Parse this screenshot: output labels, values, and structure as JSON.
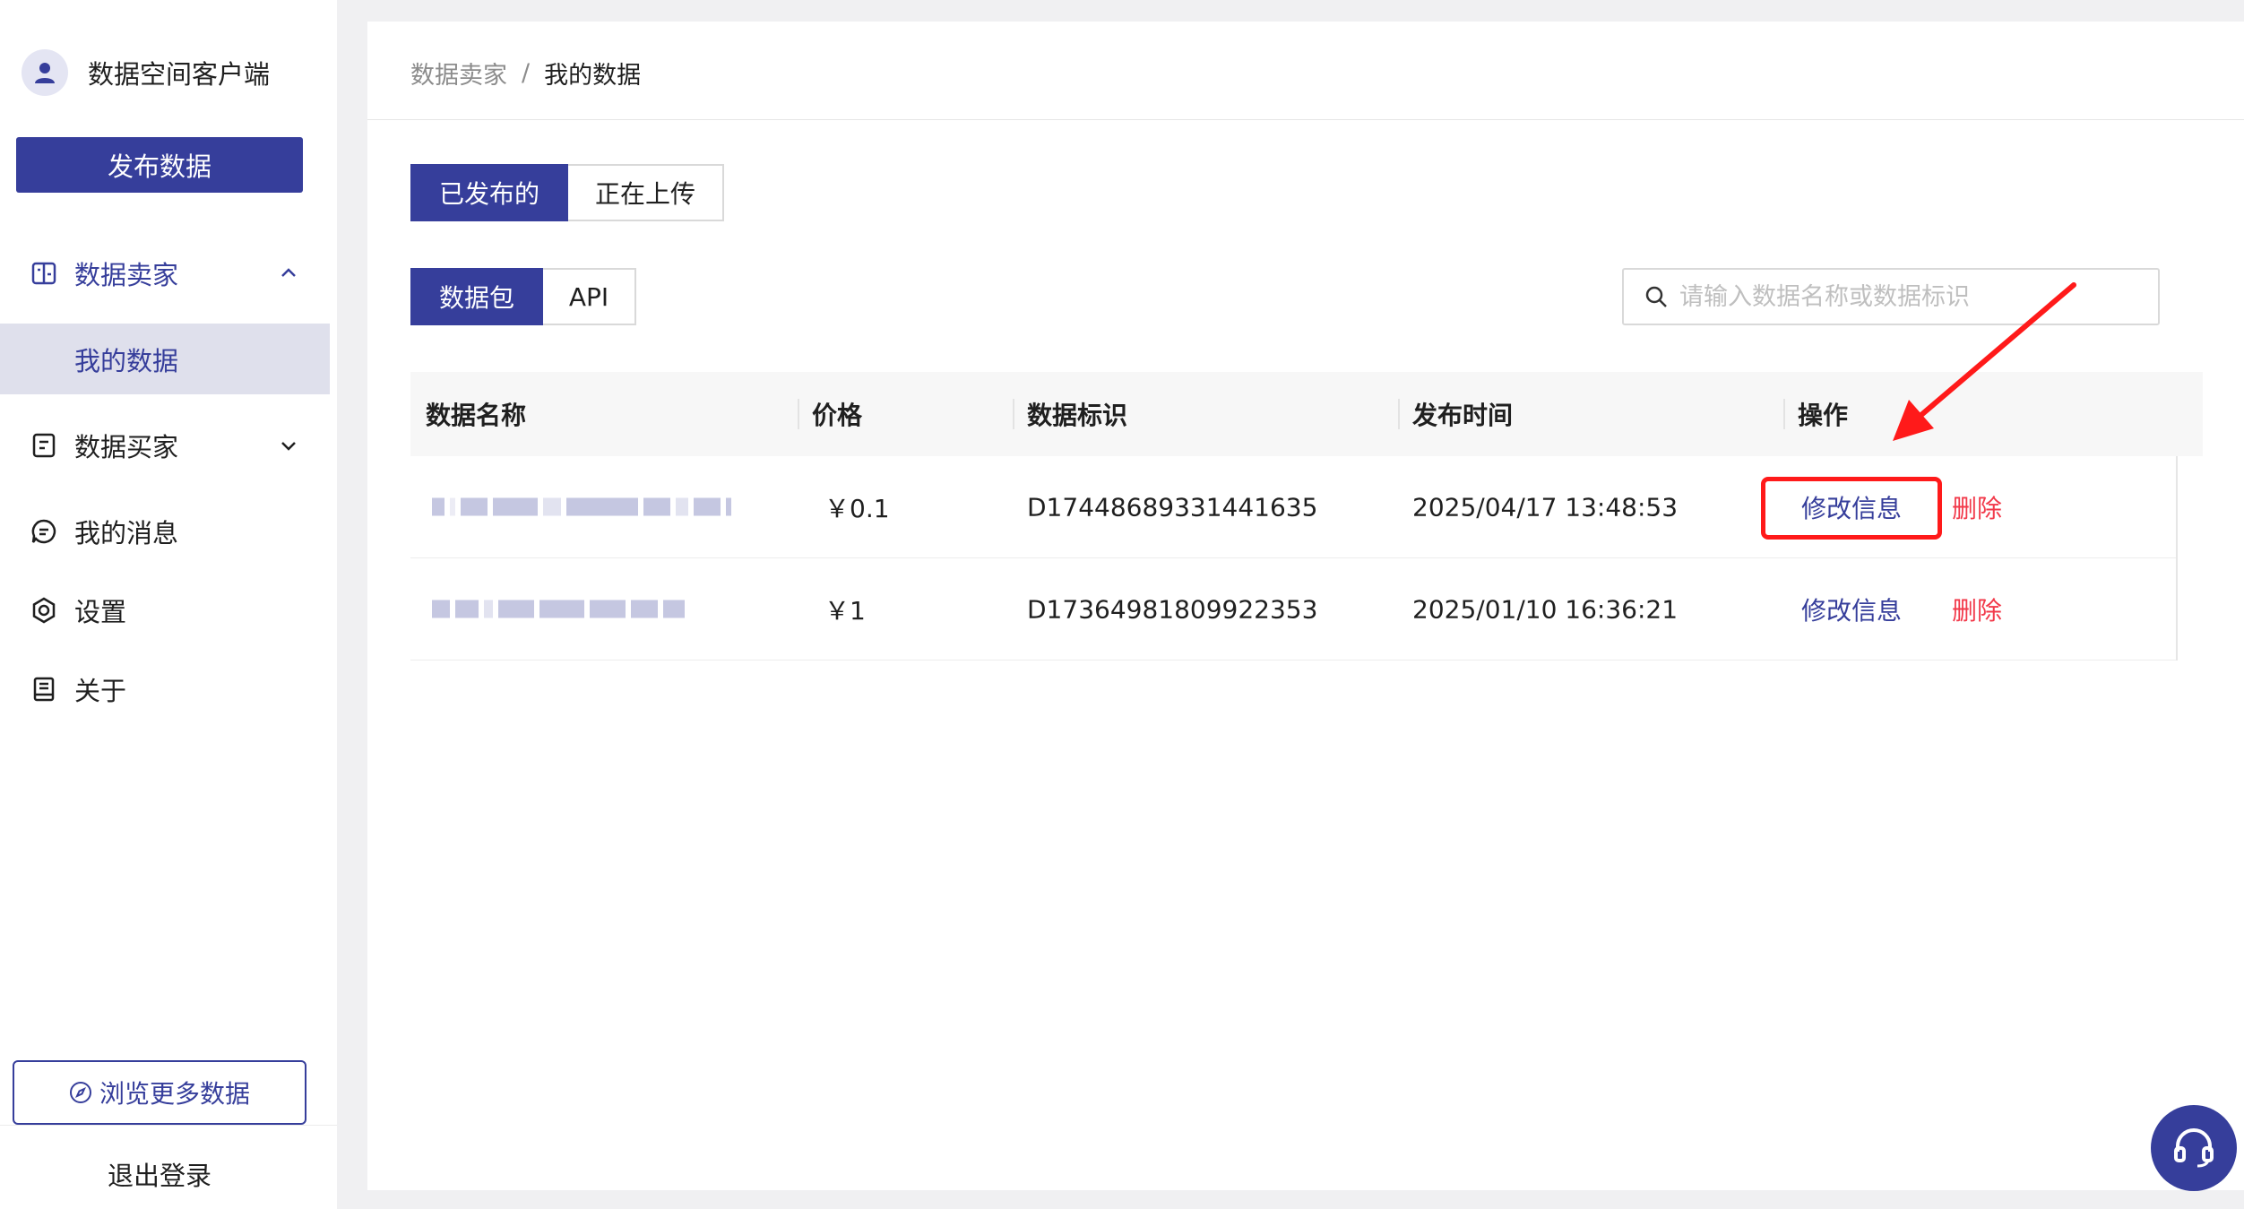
{
  "app": {
    "title": "数据空间客户端"
  },
  "sidebar": {
    "publish_label": "发布数据",
    "seller_label": "数据卖家",
    "my_data_label": "我的数据",
    "buyer_label": "数据买家",
    "messages_label": "我的消息",
    "settings_label": "设置",
    "about_label": "关于",
    "browse_label": "浏览更多数据",
    "logout_label": "退出登录"
  },
  "breadcrumb": {
    "parent": "数据卖家",
    "separator": "/",
    "current": "我的数据"
  },
  "status_tabs": [
    {
      "label": "已发布的",
      "active": true
    },
    {
      "label": "正在上传",
      "active": false
    }
  ],
  "type_tabs": [
    {
      "label": "数据包",
      "active": true
    },
    {
      "label": "API",
      "active": false
    }
  ],
  "search": {
    "placeholder": "请输入数据名称或数据标识",
    "value": ""
  },
  "table": {
    "columns": [
      "数据名称",
      "价格",
      "数据标识",
      "发布时间",
      "操作"
    ],
    "rows": [
      {
        "name": "",
        "price": "￥0.1",
        "id": "D17448689331441635",
        "time": "2025/04/17 13:48:53",
        "edit": "修改信息",
        "delete": "删除"
      },
      {
        "name": "",
        "price": "￥1",
        "id": "D17364981809922353",
        "time": "2025/01/10 16:36:21",
        "edit": "修改信息",
        "delete": "删除"
      }
    ]
  },
  "colors": {
    "primary": "#363e9b",
    "danger": "#f2394a",
    "annotation": "#ff1a1a"
  }
}
